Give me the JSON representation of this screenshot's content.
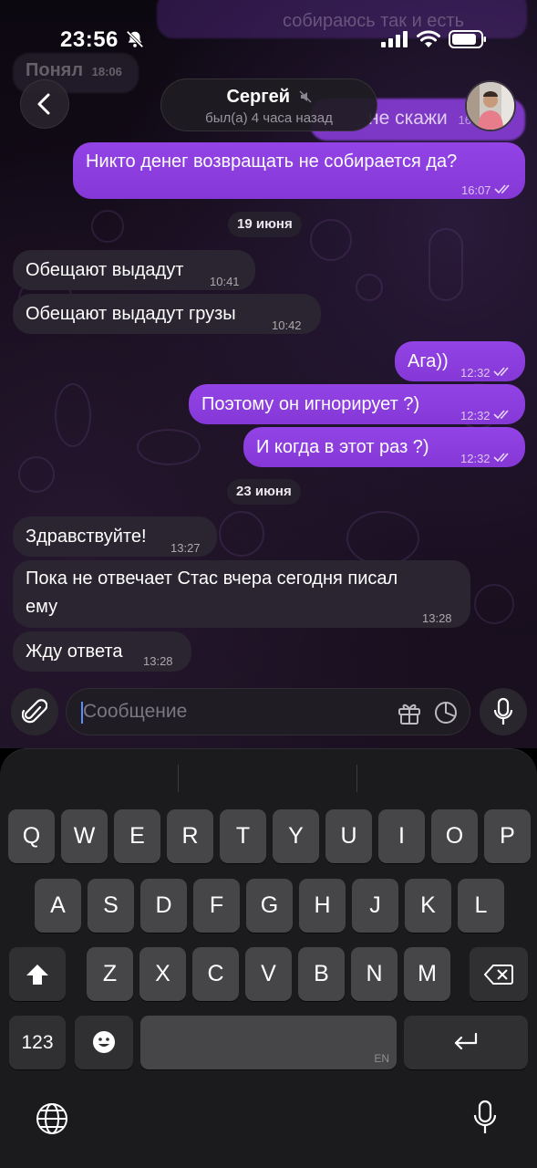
{
  "status_bar": {
    "time": "23:56"
  },
  "header": {
    "contact_name": "Сергей",
    "last_seen": "был(а) 4 часа назад"
  },
  "background_fragments": {
    "top_text": "собираюсь так и есть",
    "incoming_text": "Понял",
    "incoming_time": "18:06",
    "partial_text": "не скажи",
    "partial_time": "16:"
  },
  "messages": [
    {
      "dir": "out",
      "text": "Никто денег возвращать не собирается да?",
      "time": "16:07"
    },
    {
      "type": "date",
      "text": "19 июня"
    },
    {
      "dir": "in",
      "text": "Обещают выдадут",
      "time": "10:41"
    },
    {
      "dir": "in",
      "text": "Обещают выдадут грузы",
      "time": "10:42"
    },
    {
      "dir": "out",
      "text": "Ага))",
      "time": "12:32"
    },
    {
      "dir": "out",
      "text": "Поэтому он игнорирует ?)",
      "time": "12:32"
    },
    {
      "dir": "out",
      "text": "И когда в этот раз ?)",
      "time": "12:32"
    },
    {
      "type": "date",
      "text": "23 июня"
    },
    {
      "dir": "in",
      "text": "Здравствуйте!",
      "time": "13:27"
    },
    {
      "dir": "in",
      "text_line1": "Пока не отвечает Стас вчера сегодня писал",
      "text_line2": "ему",
      "time": "13:28"
    },
    {
      "dir": "in",
      "text": "Жду ответа",
      "time": "13:28"
    }
  ],
  "composer": {
    "placeholder": "Сообщение"
  },
  "keyboard": {
    "row1": [
      "Q",
      "W",
      "E",
      "R",
      "T",
      "Y",
      "U",
      "I",
      "O",
      "P"
    ],
    "row2": [
      "A",
      "S",
      "D",
      "F",
      "G",
      "H",
      "J",
      "K",
      "L"
    ],
    "row3": [
      "Z",
      "X",
      "C",
      "V",
      "B",
      "N",
      "M"
    ],
    "numbers_key": "123",
    "space_lang": "EN"
  },
  "colors": {
    "outgoing_bubble": "#8d3ee0",
    "incoming_bubble": "#2a2530",
    "accent": "#5a8dff"
  },
  "icons": [
    "bell-slash-icon",
    "signal-icon",
    "wifi-icon",
    "battery-icon",
    "back-chevron-icon",
    "mute-icon",
    "paperclip-icon",
    "gift-icon",
    "sticker-icon",
    "mic-icon",
    "shift-icon",
    "backspace-icon",
    "emoji-icon",
    "return-icon",
    "globe-icon",
    "dictation-icon"
  ]
}
